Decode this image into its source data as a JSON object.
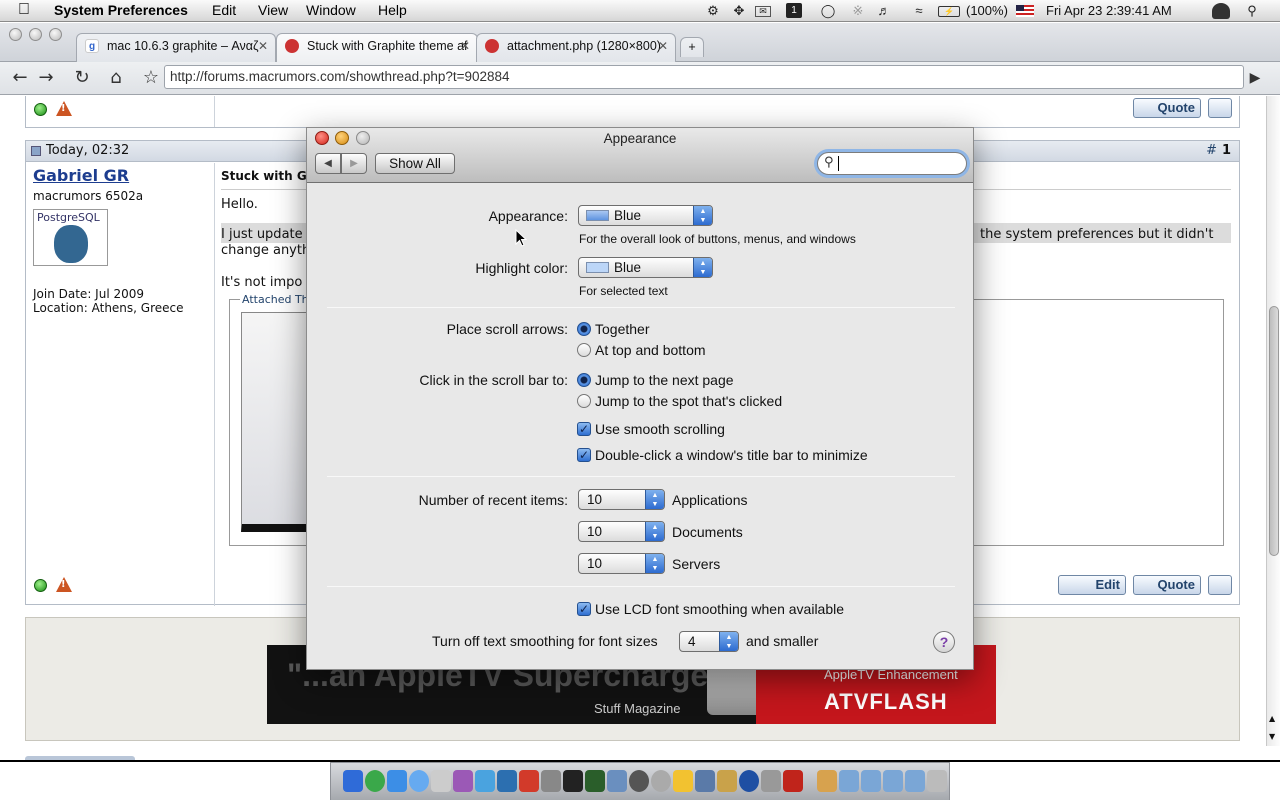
{
  "menubar": {
    "app_name": "System Preferences",
    "menus": [
      "Edit",
      "View",
      "Window",
      "Help"
    ],
    "battery": "(100%)",
    "clock": "Fri Apr 23  2:39:41 AM"
  },
  "browser": {
    "tabs": [
      {
        "label": "mac 10.6.3 graphite – Αναζ"
      },
      {
        "label": "Stuck with Graphite theme af"
      },
      {
        "label": "attachment.php (1280×800)"
      }
    ],
    "url": "http://forums.macrumors.com/showthread.php?t=902884"
  },
  "forum": {
    "post": {
      "date": "Today, 02:32",
      "number": "1",
      "author": "Gabriel GR",
      "rank": "macrumors 6502a",
      "avatar_text": "PostgreSQL",
      "join_date": "Join Date: Jul 2009",
      "location": "Location: Athens, Greece",
      "title": "Stuck with Gr",
      "line1": "Hello.",
      "line2a": "I just update",
      "line2b": "the system preferences but it didn't",
      "line3": "change anyth",
      "line4": "It's not impo",
      "attached": "Attached Thu"
    },
    "buttons": {
      "quote": "Quote",
      "edit": "Edit"
    }
  },
  "ad": {
    "headline": "\"...an AppleTV Supercharger.",
    "source": "Stuff Magazine",
    "tag": "AppleTV Enhancement",
    "brand": "ATVFLASH"
  },
  "prefs": {
    "title": "Appearance",
    "show_all": "Show All",
    "search_value": "",
    "appearance_label": "Appearance:",
    "appearance_value": "Blue",
    "appearance_hint": "For the overall look of buttons, menus, and windows",
    "highlight_label": "Highlight color:",
    "highlight_value": "Blue",
    "highlight_hint": "For selected text",
    "scroll_arrows_label": "Place scroll arrows:",
    "scroll_arrows_opt1": "Together",
    "scroll_arrows_opt2": "At top and bottom",
    "click_bar_label": "Click in the scroll bar to:",
    "click_bar_opt1": "Jump to the next page",
    "click_bar_opt2": "Jump to the spot that's clicked",
    "smooth_scrolling": "Use smooth scrolling",
    "double_click": "Double-click a window's title bar to minimize",
    "recent_label": "Number of recent items:",
    "recent_apps": "10",
    "recent_apps_label": "Applications",
    "recent_docs": "10",
    "recent_docs_label": "Documents",
    "recent_servers": "10",
    "recent_servers_label": "Servers",
    "lcd_smoothing": "Use LCD font smoothing when available",
    "smoothing_prefix": "Turn off text smoothing for font sizes",
    "smoothing_value": "4",
    "smoothing_suffix": "and smaller",
    "help": "?"
  }
}
